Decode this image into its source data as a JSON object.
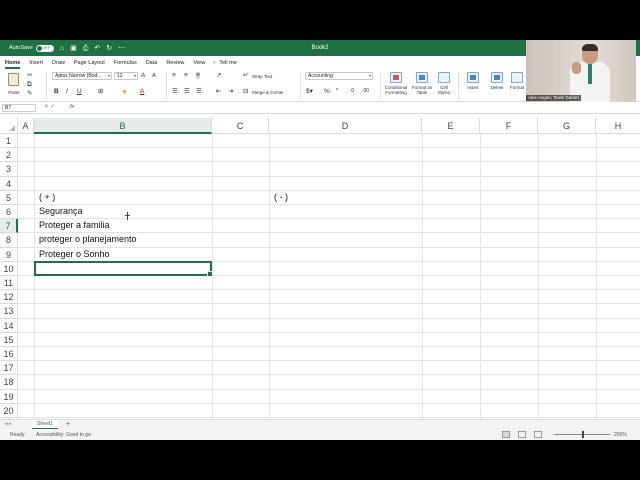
{
  "titlebar": {
    "autosave_label": "AutoSave",
    "autosave_state": "OFF",
    "doc_title": "Book2"
  },
  "tabs": [
    "Home",
    "Insert",
    "Draw",
    "Page Layout",
    "Formulas",
    "Data",
    "Review",
    "View",
    "Tell me"
  ],
  "ribbon": {
    "paste_label": "Paste",
    "font_name": "Aptos Narrow (Bod...",
    "font_size": "12",
    "wrap_text": "Wrap Text",
    "merge_center": "Merge & Center",
    "number_format": "Accounting",
    "conditional_formatting": "Conditional Formatting",
    "format_as_table": "Format as Table",
    "cell_styles": "Cell Styles",
    "insert": "Insert",
    "delete": "Delete",
    "format": "Format"
  },
  "video": {
    "participant_name": "Alex Angelo Tarek Gemm"
  },
  "formula_bar": {
    "name_box": "B7",
    "fx": "fx"
  },
  "columns": [
    "A",
    "B",
    "C",
    "D",
    "E",
    "F",
    "G",
    "H"
  ],
  "rows": [
    "1",
    "2",
    "3",
    "4",
    "5",
    "6",
    "7",
    "8",
    "9",
    "10",
    "11",
    "12",
    "13",
    "14",
    "15",
    "16",
    "17",
    "18",
    "19",
    "20"
  ],
  "cells": {
    "B2": "( + )",
    "D2": "( - )",
    "B3": "Segurança",
    "B4": "Proteger a familia",
    "B5": "proteger o planejamento",
    "B6": "Proteger o Sonho"
  },
  "sheets": {
    "active": "Sheet1",
    "add": "+"
  },
  "status": {
    "ready": "Ready",
    "accessibility": "Accessibility: Good to go",
    "zoom": "200%"
  },
  "colors": {
    "accent": "#1e7145"
  }
}
